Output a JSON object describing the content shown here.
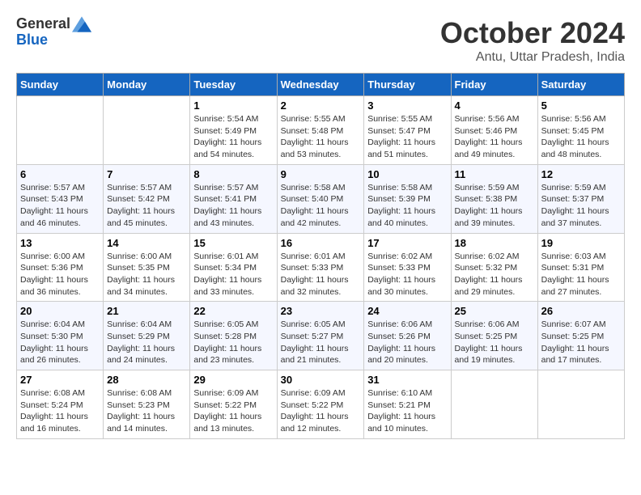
{
  "logo": {
    "line1": "General",
    "line2": "Blue"
  },
  "title": "October 2024",
  "location": "Antu, Uttar Pradesh, India",
  "days_of_week": [
    "Sunday",
    "Monday",
    "Tuesday",
    "Wednesday",
    "Thursday",
    "Friday",
    "Saturday"
  ],
  "weeks": [
    [
      {
        "day": "",
        "info": ""
      },
      {
        "day": "",
        "info": ""
      },
      {
        "day": "1",
        "info": "Sunrise: 5:54 AM\nSunset: 5:49 PM\nDaylight: 11 hours and 54 minutes."
      },
      {
        "day": "2",
        "info": "Sunrise: 5:55 AM\nSunset: 5:48 PM\nDaylight: 11 hours and 53 minutes."
      },
      {
        "day": "3",
        "info": "Sunrise: 5:55 AM\nSunset: 5:47 PM\nDaylight: 11 hours and 51 minutes."
      },
      {
        "day": "4",
        "info": "Sunrise: 5:56 AM\nSunset: 5:46 PM\nDaylight: 11 hours and 49 minutes."
      },
      {
        "day": "5",
        "info": "Sunrise: 5:56 AM\nSunset: 5:45 PM\nDaylight: 11 hours and 48 minutes."
      }
    ],
    [
      {
        "day": "6",
        "info": "Sunrise: 5:57 AM\nSunset: 5:43 PM\nDaylight: 11 hours and 46 minutes."
      },
      {
        "day": "7",
        "info": "Sunrise: 5:57 AM\nSunset: 5:42 PM\nDaylight: 11 hours and 45 minutes."
      },
      {
        "day": "8",
        "info": "Sunrise: 5:57 AM\nSunset: 5:41 PM\nDaylight: 11 hours and 43 minutes."
      },
      {
        "day": "9",
        "info": "Sunrise: 5:58 AM\nSunset: 5:40 PM\nDaylight: 11 hours and 42 minutes."
      },
      {
        "day": "10",
        "info": "Sunrise: 5:58 AM\nSunset: 5:39 PM\nDaylight: 11 hours and 40 minutes."
      },
      {
        "day": "11",
        "info": "Sunrise: 5:59 AM\nSunset: 5:38 PM\nDaylight: 11 hours and 39 minutes."
      },
      {
        "day": "12",
        "info": "Sunrise: 5:59 AM\nSunset: 5:37 PM\nDaylight: 11 hours and 37 minutes."
      }
    ],
    [
      {
        "day": "13",
        "info": "Sunrise: 6:00 AM\nSunset: 5:36 PM\nDaylight: 11 hours and 36 minutes."
      },
      {
        "day": "14",
        "info": "Sunrise: 6:00 AM\nSunset: 5:35 PM\nDaylight: 11 hours and 34 minutes."
      },
      {
        "day": "15",
        "info": "Sunrise: 6:01 AM\nSunset: 5:34 PM\nDaylight: 11 hours and 33 minutes."
      },
      {
        "day": "16",
        "info": "Sunrise: 6:01 AM\nSunset: 5:33 PM\nDaylight: 11 hours and 32 minutes."
      },
      {
        "day": "17",
        "info": "Sunrise: 6:02 AM\nSunset: 5:33 PM\nDaylight: 11 hours and 30 minutes."
      },
      {
        "day": "18",
        "info": "Sunrise: 6:02 AM\nSunset: 5:32 PM\nDaylight: 11 hours and 29 minutes."
      },
      {
        "day": "19",
        "info": "Sunrise: 6:03 AM\nSunset: 5:31 PM\nDaylight: 11 hours and 27 minutes."
      }
    ],
    [
      {
        "day": "20",
        "info": "Sunrise: 6:04 AM\nSunset: 5:30 PM\nDaylight: 11 hours and 26 minutes."
      },
      {
        "day": "21",
        "info": "Sunrise: 6:04 AM\nSunset: 5:29 PM\nDaylight: 11 hours and 24 minutes."
      },
      {
        "day": "22",
        "info": "Sunrise: 6:05 AM\nSunset: 5:28 PM\nDaylight: 11 hours and 23 minutes."
      },
      {
        "day": "23",
        "info": "Sunrise: 6:05 AM\nSunset: 5:27 PM\nDaylight: 11 hours and 21 minutes."
      },
      {
        "day": "24",
        "info": "Sunrise: 6:06 AM\nSunset: 5:26 PM\nDaylight: 11 hours and 20 minutes."
      },
      {
        "day": "25",
        "info": "Sunrise: 6:06 AM\nSunset: 5:25 PM\nDaylight: 11 hours and 19 minutes."
      },
      {
        "day": "26",
        "info": "Sunrise: 6:07 AM\nSunset: 5:25 PM\nDaylight: 11 hours and 17 minutes."
      }
    ],
    [
      {
        "day": "27",
        "info": "Sunrise: 6:08 AM\nSunset: 5:24 PM\nDaylight: 11 hours and 16 minutes."
      },
      {
        "day": "28",
        "info": "Sunrise: 6:08 AM\nSunset: 5:23 PM\nDaylight: 11 hours and 14 minutes."
      },
      {
        "day": "29",
        "info": "Sunrise: 6:09 AM\nSunset: 5:22 PM\nDaylight: 11 hours and 13 minutes."
      },
      {
        "day": "30",
        "info": "Sunrise: 6:09 AM\nSunset: 5:22 PM\nDaylight: 11 hours and 12 minutes."
      },
      {
        "day": "31",
        "info": "Sunrise: 6:10 AM\nSunset: 5:21 PM\nDaylight: 11 hours and 10 minutes."
      },
      {
        "day": "",
        "info": ""
      },
      {
        "day": "",
        "info": ""
      }
    ]
  ]
}
